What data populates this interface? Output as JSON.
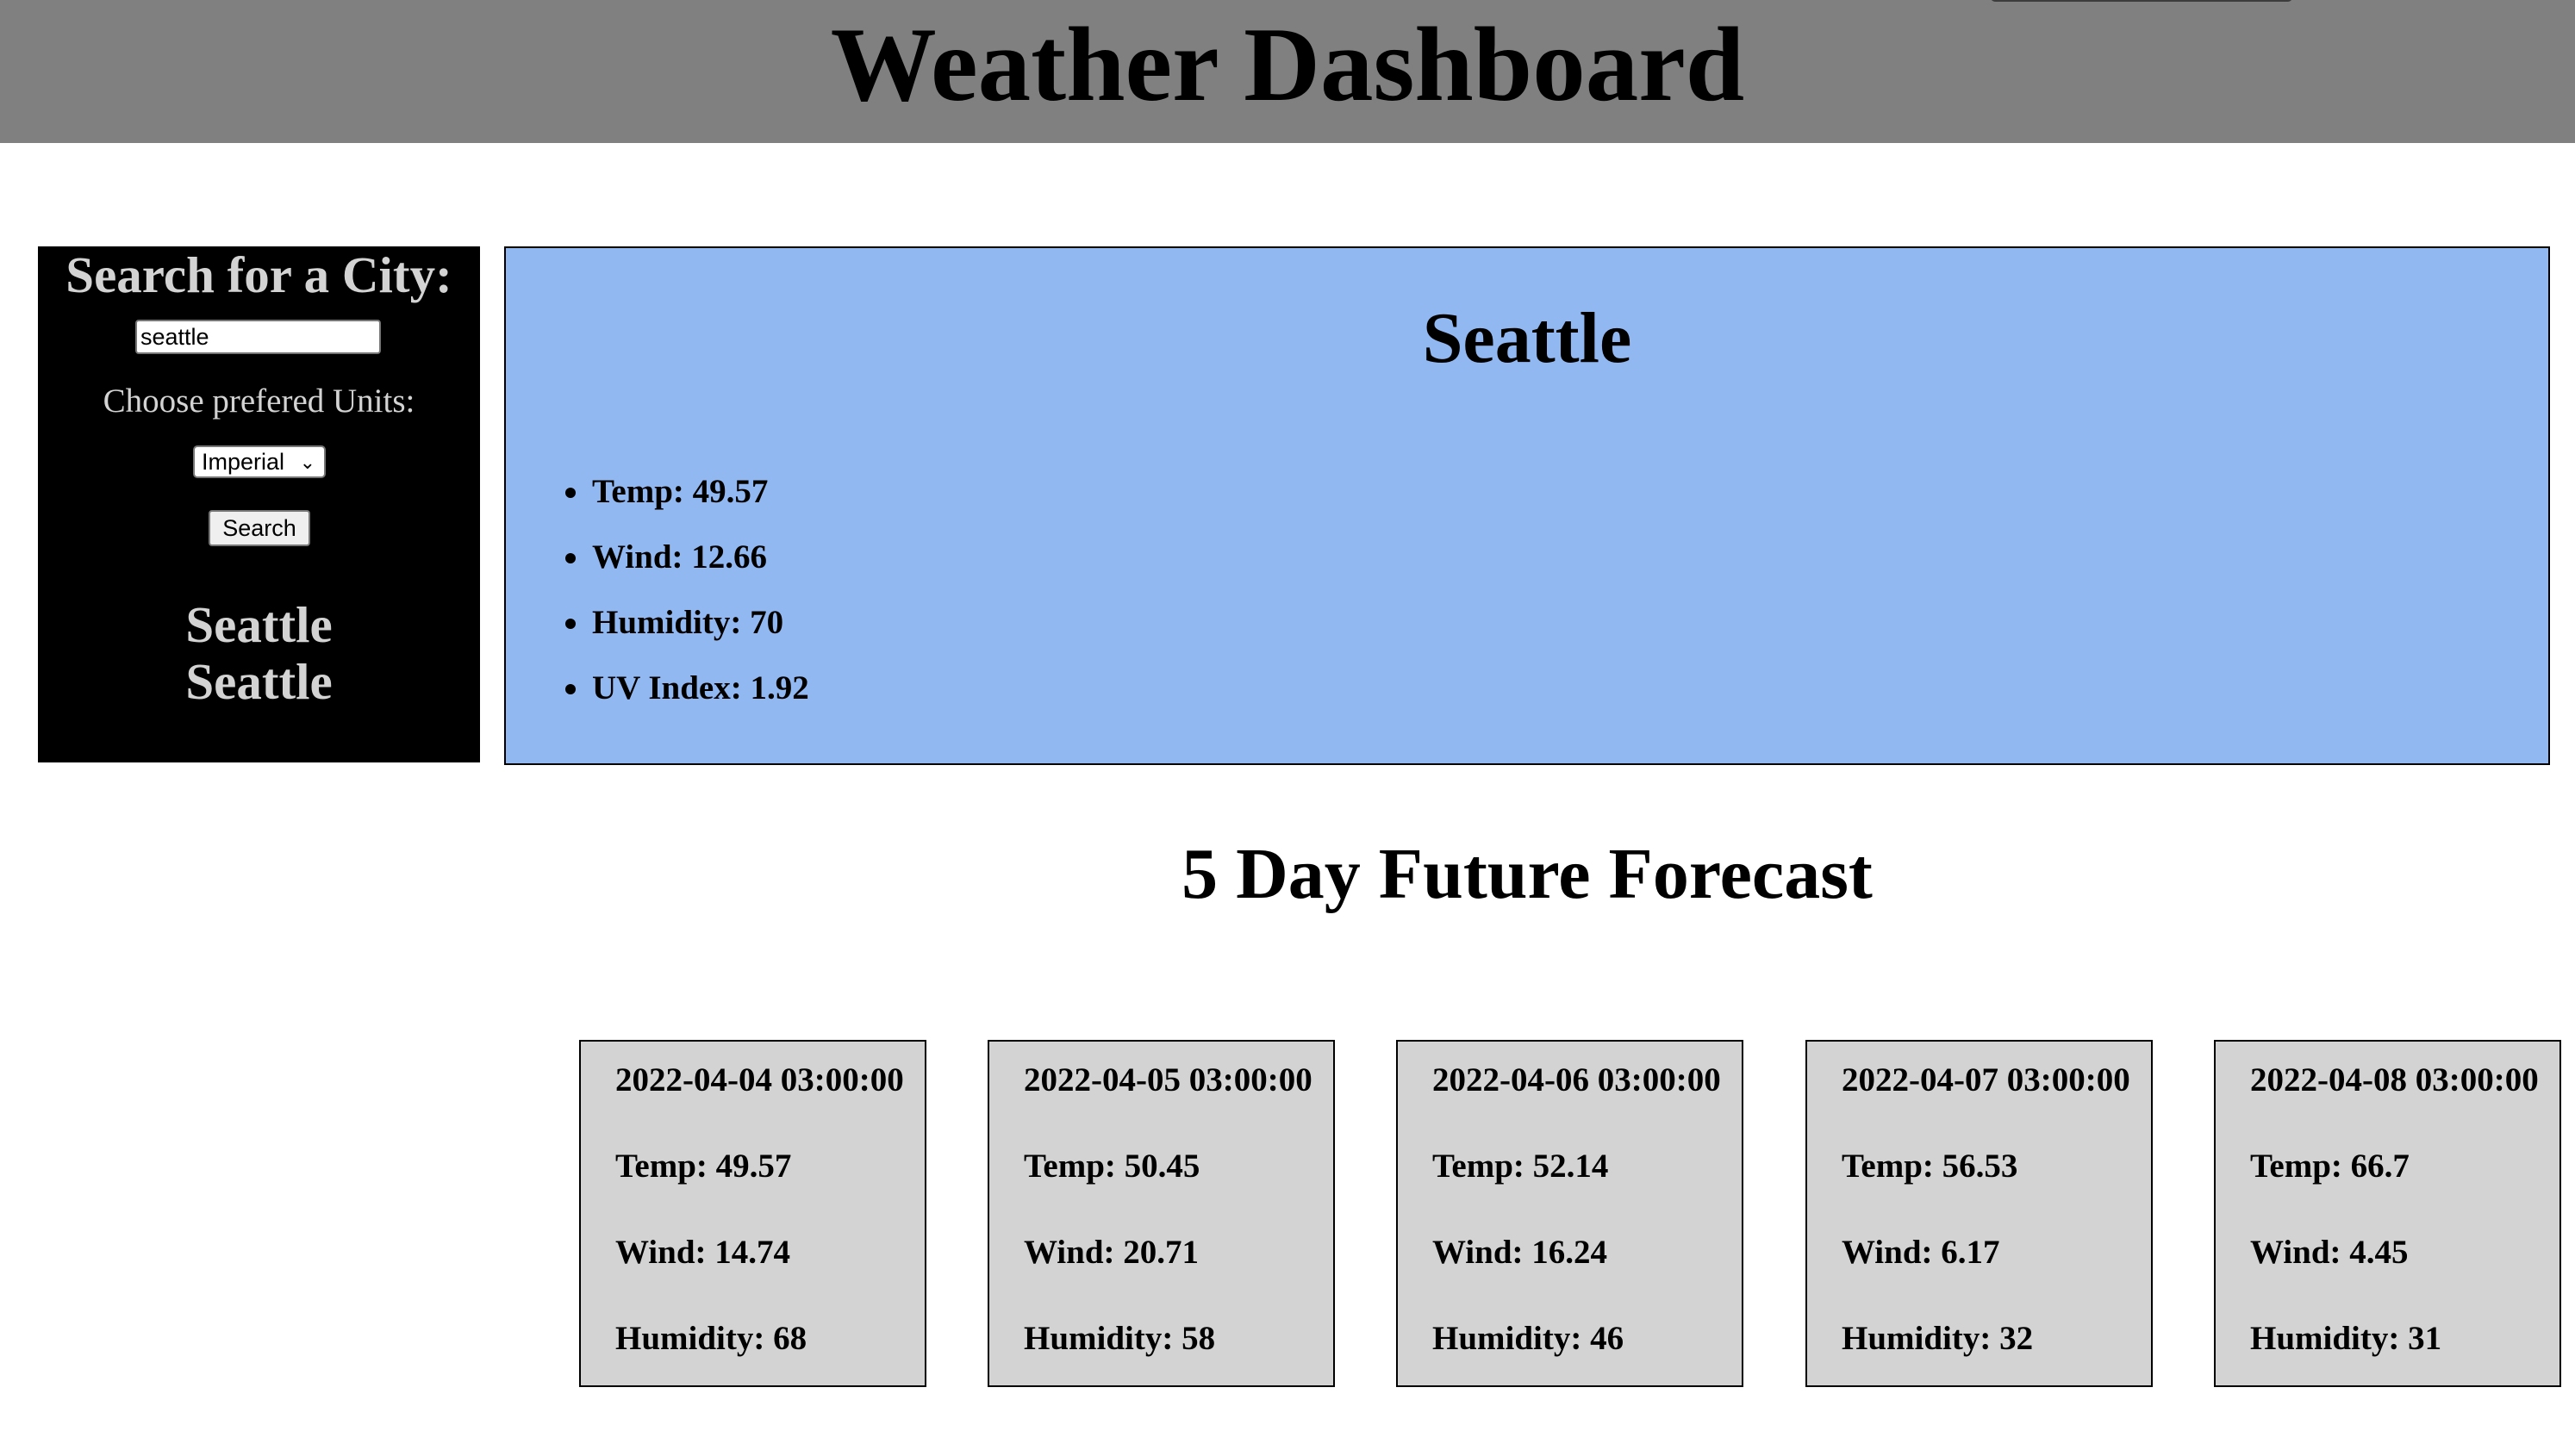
{
  "header": {
    "title": "Weather Dashboard"
  },
  "sidebar": {
    "title": "Search for a City:",
    "search_value": "seattle",
    "units_label": "Choose prefered Units:",
    "units_selected": "Imperial",
    "search_button": "Search",
    "history": [
      "Seattle",
      "Seattle"
    ]
  },
  "current": {
    "city": "Seattle",
    "items": [
      "Temp: 49.57",
      "Wind: 12.66",
      "Humidity: 70",
      "UV Index: 1.92"
    ],
    "background": "#92b8f2"
  },
  "forecast": {
    "title": "5 Day Future Forecast",
    "days": [
      {
        "date": "2022-04-04 03:00:00",
        "temp": "Temp: 49.57",
        "wind": "Wind: 14.74",
        "humidity": "Humidity: 68"
      },
      {
        "date": "2022-04-05 03:00:00",
        "temp": "Temp: 50.45",
        "wind": "Wind: 20.71",
        "humidity": "Humidity: 58"
      },
      {
        "date": "2022-04-06 03:00:00",
        "temp": "Temp: 52.14",
        "wind": "Wind: 16.24",
        "humidity": "Humidity: 46"
      },
      {
        "date": "2022-04-07 03:00:00",
        "temp": "Temp: 56.53",
        "wind": "Wind: 6.17",
        "humidity": "Humidity: 32"
      },
      {
        "date": "2022-04-08 03:00:00",
        "temp": "Temp: 66.7",
        "wind": "Wind: 4.45",
        "humidity": "Humidity: 31"
      }
    ]
  },
  "colors": {
    "header": "#808080",
    "sidebar": "#000000",
    "sidebar_text": "#d3d3d3",
    "card": "#d3d3d3"
  },
  "icons": {
    "select_chevron": "chevron-down-icon"
  }
}
